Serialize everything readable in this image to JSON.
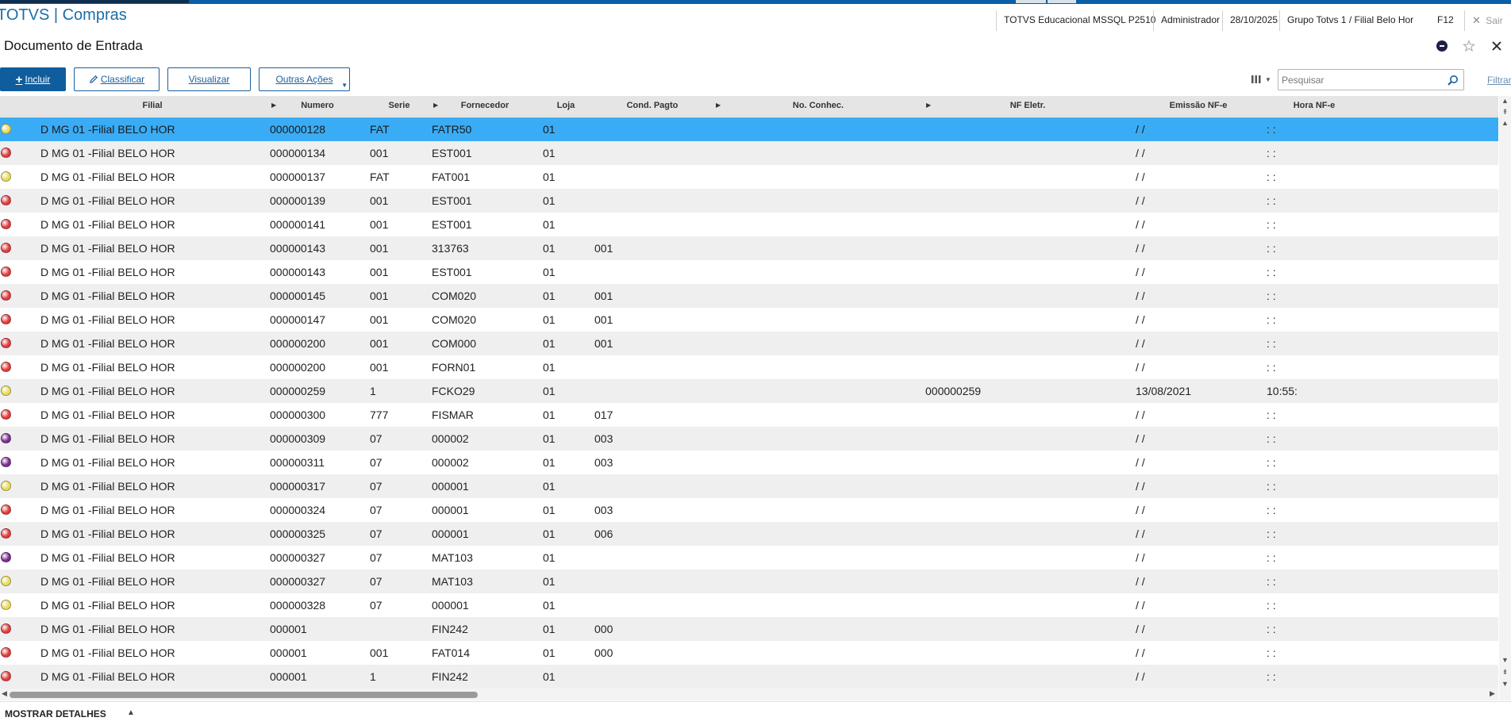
{
  "app": {
    "title": "TOTVS | Compras"
  },
  "status_bar": {
    "environment": "TOTVS Educacional MSSQL P2510",
    "user": "Administrador",
    "date": "28/10/2025",
    "branch": "Grupo Totvs 1 / Filial Belo Hor",
    "shortcut": "F12",
    "exit_label": "Sair"
  },
  "page": {
    "title": "Documento de Entrada"
  },
  "toolbar": {
    "include_label": "Incluir",
    "classify_label": "Classificar",
    "view_label": "Visualizar",
    "other_actions_label": "Outras Ações"
  },
  "search": {
    "placeholder": "Pesquisar",
    "filter_label": "Filtrar"
  },
  "grid": {
    "columns": {
      "filial": "Filial",
      "numero": "Numero",
      "serie": "Serie",
      "fornecedor": "Fornecedor",
      "loja": "Loja",
      "cond_pagto": "Cond. Pagto",
      "no_conhec": "No. Conhec.",
      "nf_eletr": "NF Eletr.",
      "emissao": "Emissão NF-e",
      "hora": "Hora NF-e"
    },
    "colors": {
      "red": "#e23c3c",
      "yellow": "#e8dc5a",
      "purple": "#7b2d8e",
      "selected_row": "#3aacf5"
    },
    "rows": [
      {
        "status": "yellow",
        "filial": "D MG 01 -Filial BELO HOR",
        "numero": "000000128",
        "serie": "FAT",
        "fornecedor": "FATR50",
        "loja": "01",
        "cond": "",
        "nf": "",
        "emissao": "/ /",
        "hora": ": :",
        "selected": true
      },
      {
        "status": "red",
        "filial": "D MG 01 -Filial BELO HOR",
        "numero": "000000134",
        "serie": "001",
        "fornecedor": "EST001",
        "loja": "01",
        "cond": "",
        "nf": "",
        "emissao": "/ /",
        "hora": ": :"
      },
      {
        "status": "yellow",
        "filial": "D MG 01 -Filial BELO HOR",
        "numero": "000000137",
        "serie": "FAT",
        "fornecedor": "FAT001",
        "loja": "01",
        "cond": "",
        "nf": "",
        "emissao": "/ /",
        "hora": ": :"
      },
      {
        "status": "red",
        "filial": "D MG 01 -Filial BELO HOR",
        "numero": "000000139",
        "serie": "001",
        "fornecedor": "EST001",
        "loja": "01",
        "cond": "",
        "nf": "",
        "emissao": "/ /",
        "hora": ": :"
      },
      {
        "status": "red",
        "filial": "D MG 01 -Filial BELO HOR",
        "numero": "000000141",
        "serie": "001",
        "fornecedor": "EST001",
        "loja": "01",
        "cond": "",
        "nf": "",
        "emissao": "/ /",
        "hora": ": :"
      },
      {
        "status": "red",
        "filial": "D MG 01 -Filial BELO HOR",
        "numero": "000000143",
        "serie": "001",
        "fornecedor": "313763",
        "loja": "01",
        "cond": "001",
        "nf": "",
        "emissao": "/ /",
        "hora": ": :"
      },
      {
        "status": "red",
        "filial": "D MG 01 -Filial BELO HOR",
        "numero": "000000143",
        "serie": "001",
        "fornecedor": "EST001",
        "loja": "01",
        "cond": "",
        "nf": "",
        "emissao": "/ /",
        "hora": ": :"
      },
      {
        "status": "red",
        "filial": "D MG 01 -Filial BELO HOR",
        "numero": "000000145",
        "serie": "001",
        "fornecedor": "COM020",
        "loja": "01",
        "cond": "001",
        "nf": "",
        "emissao": "/ /",
        "hora": ": :"
      },
      {
        "status": "red",
        "filial": "D MG 01 -Filial BELO HOR",
        "numero": "000000147",
        "serie": "001",
        "fornecedor": "COM020",
        "loja": "01",
        "cond": "001",
        "nf": "",
        "emissao": "/ /",
        "hora": ": :"
      },
      {
        "status": "red",
        "filial": "D MG 01 -Filial BELO HOR",
        "numero": "000000200",
        "serie": "001",
        "fornecedor": "COM000",
        "loja": "01",
        "cond": "001",
        "nf": "",
        "emissao": "/ /",
        "hora": ": :"
      },
      {
        "status": "red",
        "filial": "D MG 01 -Filial BELO HOR",
        "numero": "000000200",
        "serie": "001",
        "fornecedor": "FORN01",
        "loja": "01",
        "cond": "",
        "nf": "",
        "emissao": "/ /",
        "hora": ": :"
      },
      {
        "status": "yellow",
        "filial": "D MG 01 -Filial BELO HOR",
        "numero": "000000259",
        "serie": "1",
        "fornecedor": "FCKO29",
        "loja": "01",
        "cond": "",
        "nf": "000000259",
        "emissao": "13/08/2021",
        "hora": "10:55:"
      },
      {
        "status": "red",
        "filial": "D MG 01 -Filial BELO HOR",
        "numero": "000000300",
        "serie": "777",
        "fornecedor": "FISMAR",
        "loja": "01",
        "cond": "017",
        "nf": "",
        "emissao": "/ /",
        "hora": ": :"
      },
      {
        "status": "purple",
        "filial": "D MG 01 -Filial BELO HOR",
        "numero": "000000309",
        "serie": "07",
        "fornecedor": "000002",
        "loja": "01",
        "cond": "003",
        "nf": "",
        "emissao": "/ /",
        "hora": ": :"
      },
      {
        "status": "purple",
        "filial": "D MG 01 -Filial BELO HOR",
        "numero": "000000311",
        "serie": "07",
        "fornecedor": "000002",
        "loja": "01",
        "cond": "003",
        "nf": "",
        "emissao": "/ /",
        "hora": ": :"
      },
      {
        "status": "yellow",
        "filial": "D MG 01 -Filial BELO HOR",
        "numero": "000000317",
        "serie": "07",
        "fornecedor": "000001",
        "loja": "01",
        "cond": "",
        "nf": "",
        "emissao": "/ /",
        "hora": ": :"
      },
      {
        "status": "red",
        "filial": "D MG 01 -Filial BELO HOR",
        "numero": "000000324",
        "serie": "07",
        "fornecedor": "000001",
        "loja": "01",
        "cond": "003",
        "nf": "",
        "emissao": "/ /",
        "hora": ": :"
      },
      {
        "status": "red",
        "filial": "D MG 01 -Filial BELO HOR",
        "numero": "000000325",
        "serie": "07",
        "fornecedor": "000001",
        "loja": "01",
        "cond": "006",
        "nf": "",
        "emissao": "/ /",
        "hora": ": :"
      },
      {
        "status": "purple",
        "filial": "D MG 01 -Filial BELO HOR",
        "numero": "000000327",
        "serie": "07",
        "fornecedor": "MAT103",
        "loja": "01",
        "cond": "",
        "nf": "",
        "emissao": "/ /",
        "hora": ": :"
      },
      {
        "status": "yellow",
        "filial": "D MG 01 -Filial BELO HOR",
        "numero": "000000327",
        "serie": "07",
        "fornecedor": "MAT103",
        "loja": "01",
        "cond": "",
        "nf": "",
        "emissao": "/ /",
        "hora": ": :"
      },
      {
        "status": "yellow",
        "filial": "D MG 01 -Filial BELO HOR",
        "numero": "000000328",
        "serie": "07",
        "fornecedor": "000001",
        "loja": "01",
        "cond": "",
        "nf": "",
        "emissao": "/ /",
        "hora": ": :"
      },
      {
        "status": "red",
        "filial": "D MG 01 -Filial BELO HOR",
        "numero": "000001",
        "serie": "",
        "fornecedor": "FIN242",
        "loja": "01",
        "cond": "000",
        "nf": "",
        "emissao": "/ /",
        "hora": ": :"
      },
      {
        "status": "red",
        "filial": "D MG 01 -Filial BELO HOR",
        "numero": "000001",
        "serie": "001",
        "fornecedor": "FAT014",
        "loja": "01",
        "cond": "000",
        "nf": "",
        "emissao": "/ /",
        "hora": ": :"
      },
      {
        "status": "red",
        "filial": "D MG 01 -Filial BELO HOR",
        "numero": "000001",
        "serie": "1",
        "fornecedor": "FIN242",
        "loja": "01",
        "cond": "",
        "nf": "",
        "emissao": "/ /",
        "hora": ": :"
      }
    ]
  },
  "footer": {
    "details_label": "MOSTRAR DETALHES"
  },
  "icons": {
    "add": "add-icon",
    "edit": "pencil-icon",
    "search": "search-icon",
    "columns": "columns-icon",
    "close": "close-icon",
    "favorite": "star-icon",
    "settings": "settings-icon"
  }
}
